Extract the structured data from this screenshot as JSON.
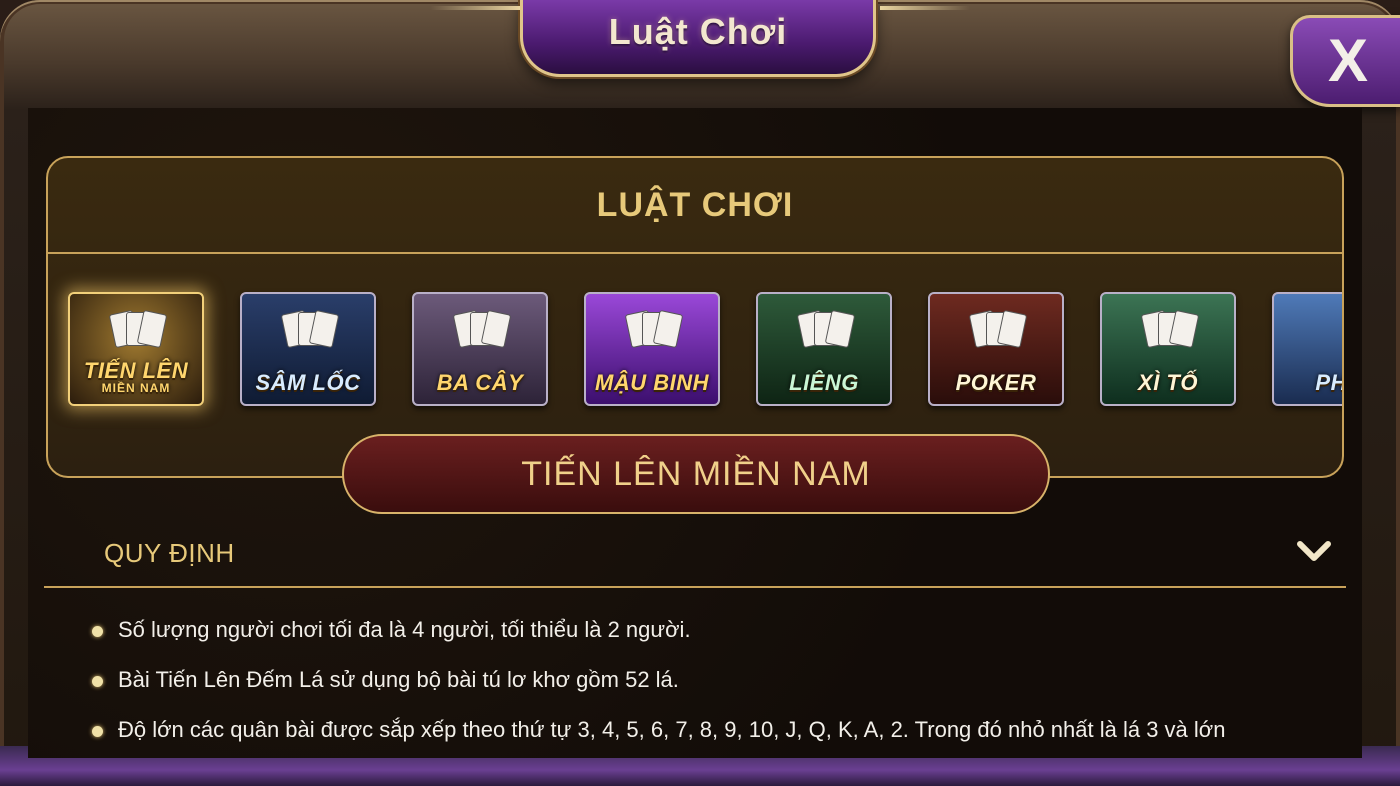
{
  "header": {
    "title": "Luật Chơi",
    "close_label": "X"
  },
  "panel": {
    "title": "LUẬT CHƠI"
  },
  "games": [
    {
      "label": "TIẾN LÊN",
      "sub": "MIỀN NAM",
      "active": true
    },
    {
      "label": "SÂM LỐC",
      "sub": "",
      "active": false
    },
    {
      "label": "BA CÂY",
      "sub": "",
      "active": false
    },
    {
      "label": "MẬU BINH",
      "sub": "",
      "active": false
    },
    {
      "label": "LIÊNG",
      "sub": "",
      "active": false
    },
    {
      "label": "POKER",
      "sub": "",
      "active": false
    },
    {
      "label": "XÌ TỐ",
      "sub": "",
      "active": false
    },
    {
      "label": "PHỎ",
      "sub": "",
      "active": false
    }
  ],
  "selected_game": "TIẾN LÊN MIỀN NAM",
  "section": {
    "title": "QUY ĐỊNH",
    "expanded": true
  },
  "rules": [
    "Số lượng người chơi tối đa là 4 người, tối thiểu là 2 người.",
    "Bài Tiến Lên Đếm Lá sử dụng bộ bài tú lơ khơ gồm 52 lá.",
    "Độ lớn các quân bài được sắp xếp theo thứ tự 3, 4, 5, 6, 7, 8, 9, 10, J, Q, K, A, 2. Trong đó nhỏ nhất là lá 3 và lớn"
  ],
  "colors": {
    "gold": "#e7c97a",
    "purple": "#7a3aa8",
    "panel": "#3a2a10"
  }
}
